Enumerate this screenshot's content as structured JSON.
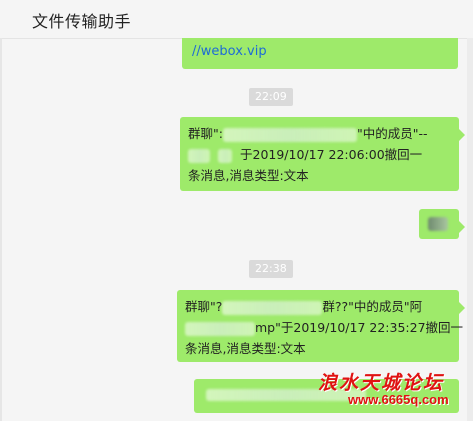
{
  "window": {
    "title": "文件传输助手"
  },
  "messages": {
    "m1": {
      "text": "//webox.vip"
    },
    "time1": "22:09",
    "m2": {
      "line1_prefix": "群聊\":",
      "line1_suffix": "\"中的成员\"--",
      "line2_suffix": "于2019/10/17 22:06:00撤回一",
      "line3": "条消息,消息类型:文本"
    },
    "m3": {
      "text": ""
    },
    "time2": "22:38",
    "m4": {
      "line1_prefix": "群聊\"?",
      "line1_suffix": "群??\"中的成员\"阿",
      "line2_suffix": "mp\"于2019/10/17 22:35:27撤回一",
      "line3": "条消息,消息类型:文本"
    }
  },
  "watermark": {
    "top": "浪水天城论坛",
    "bottom": "www.6665q.com"
  },
  "colors": {
    "bubble": "#9eea6a",
    "background": "#f5f5f5",
    "link": "#1d6bd6",
    "watermark": "#e01212"
  }
}
